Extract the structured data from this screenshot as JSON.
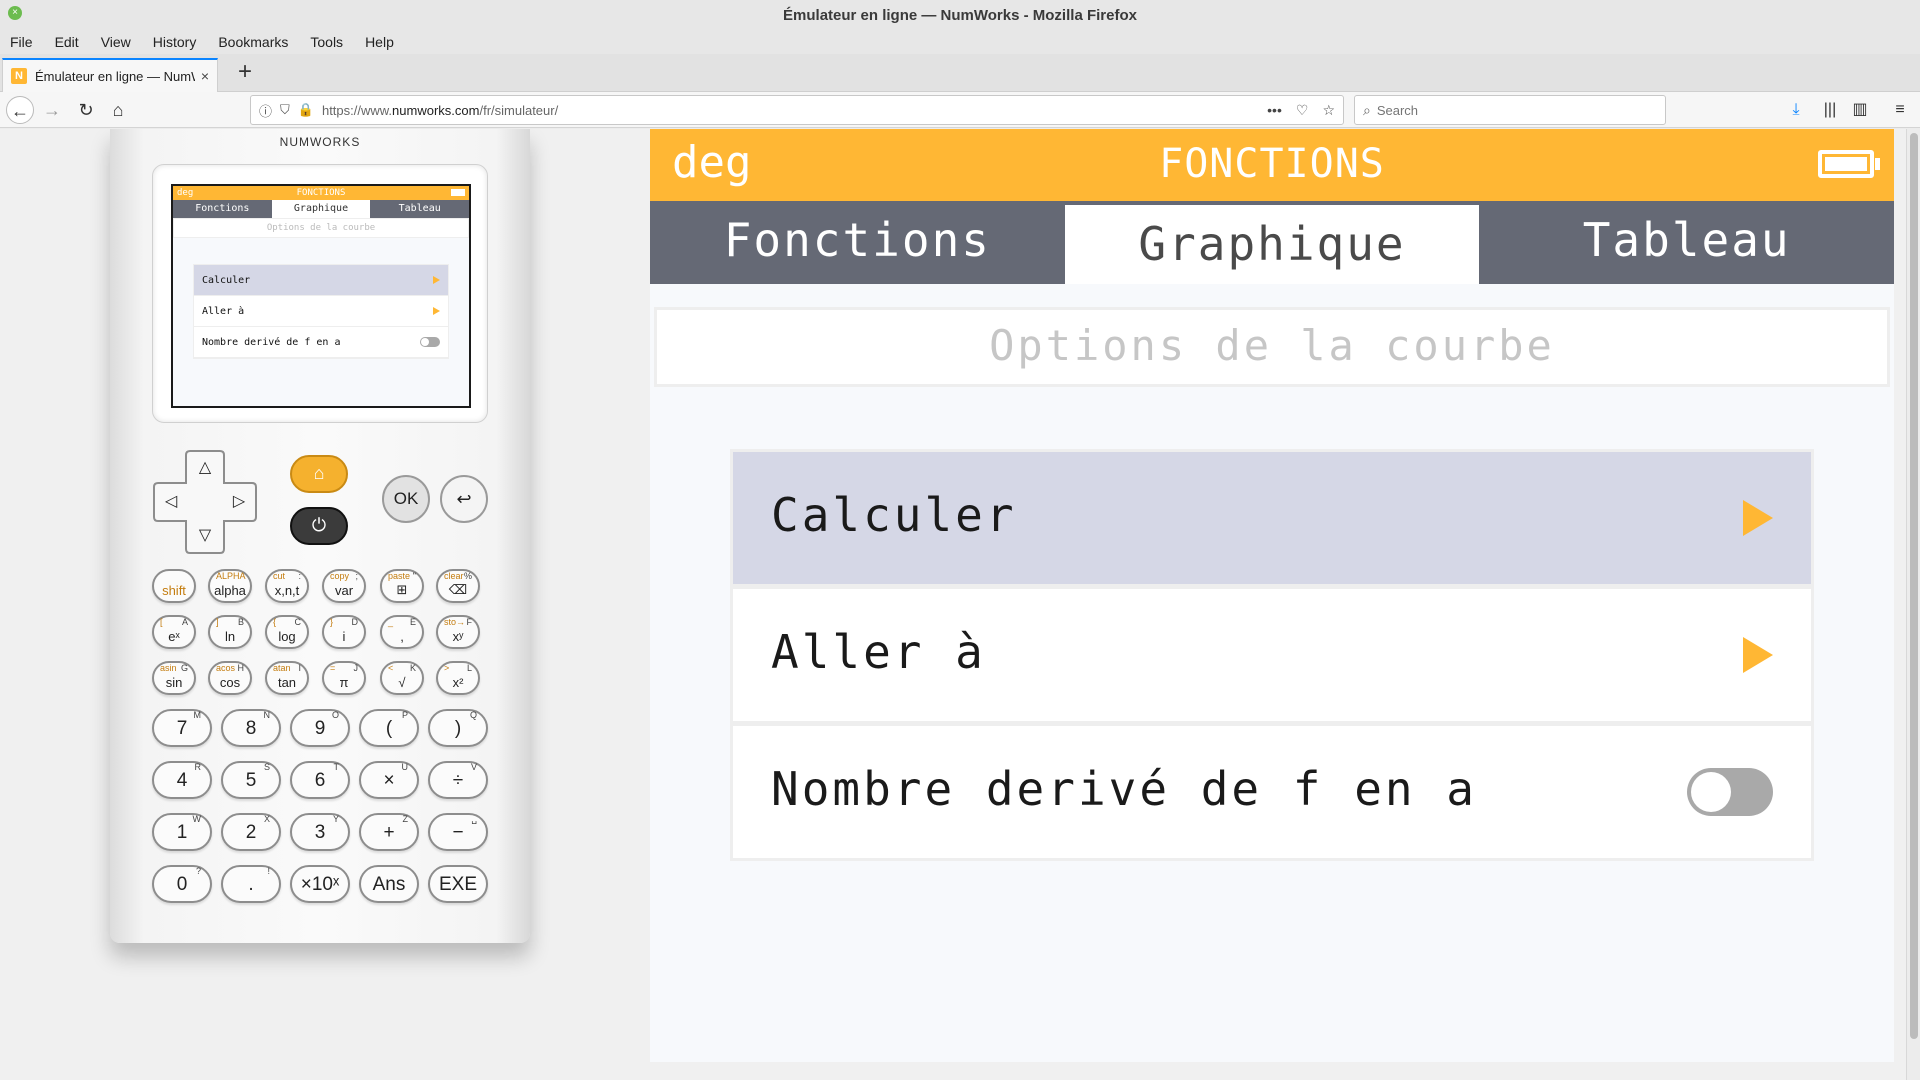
{
  "window": {
    "title": "Émulateur en ligne — NumWorks - Mozilla Firefox",
    "close_glyph": "×"
  },
  "menu": [
    "File",
    "Edit",
    "View",
    "History",
    "Bookmarks",
    "Tools",
    "Help"
  ],
  "tab": {
    "favicon": "N",
    "title": "Émulateur en ligne — NumWorks",
    "close": "×",
    "new": "+"
  },
  "nav": {
    "back": "←",
    "forward": "→",
    "reload": "↻",
    "home": "⌂",
    "url_prefix": "https://www.",
    "url_domain": "numworks.com",
    "url_path": "/fr/simulateur/",
    "page_actions": [
      "•••",
      "♡",
      "☆"
    ],
    "search_placeholder": "Search",
    "icons": {
      "download": "⤓",
      "library": "|||",
      "sidebar": "▥",
      "menu": "≡"
    }
  },
  "calculator": {
    "brand": "NUMWORKS",
    "mini_screen": {
      "left": "deg",
      "title": "FONCTIONS",
      "tabs": [
        "Fonctions",
        "Graphique",
        "Tableau"
      ],
      "subtitle": "Options de la courbe",
      "rows": [
        "Calculer",
        "Aller à",
        "Nombre derivé de f en a"
      ]
    },
    "dpad": {
      "up": "△",
      "down": "▽",
      "left": "◁",
      "right": "▷"
    },
    "home_key": "⌂",
    "power_key": "⏻",
    "ok_key": "OK",
    "back_key": "↩",
    "keys": [
      {
        "main": "shift",
        "sub": "",
        "alpha": ""
      },
      {
        "main": "alpha",
        "sub": "ALPHA",
        "alpha": ""
      },
      {
        "main": "x,n,t",
        "sub": "cut",
        "alpha": ":"
      },
      {
        "main": "var",
        "sub": "copy",
        "alpha": ";"
      },
      {
        "main": "⊞",
        "sub": "paste",
        "alpha": "\""
      },
      {
        "main": "⌫",
        "sub": "clear",
        "alpha": "%"
      },
      {
        "main": "eˣ",
        "sub": "[",
        "alpha": "A"
      },
      {
        "main": "ln",
        "sub": "]",
        "alpha": "B"
      },
      {
        "main": "log",
        "sub": "{",
        "alpha": "C"
      },
      {
        "main": "i",
        "sub": "}",
        "alpha": "D"
      },
      {
        "main": ",",
        "sub": "_",
        "alpha": "E"
      },
      {
        "main": "xʸ",
        "sub": "sto→",
        "alpha": "F"
      },
      {
        "main": "sin",
        "sub": "asin",
        "alpha": "G"
      },
      {
        "main": "cos",
        "sub": "acos",
        "alpha": "H"
      },
      {
        "main": "tan",
        "sub": "atan",
        "alpha": "I"
      },
      {
        "main": "π",
        "sub": "=",
        "alpha": "J"
      },
      {
        "main": "√",
        "sub": "<",
        "alpha": "K"
      },
      {
        "main": "x²",
        "sub": ">",
        "alpha": "L"
      }
    ],
    "num_keys": [
      {
        "main": "7",
        "alpha": "M"
      },
      {
        "main": "8",
        "alpha": "N"
      },
      {
        "main": "9",
        "alpha": "O"
      },
      {
        "main": "(",
        "alpha": "P"
      },
      {
        "main": ")",
        "alpha": "Q"
      },
      {
        "main": "4",
        "alpha": "R"
      },
      {
        "main": "5",
        "alpha": "S"
      },
      {
        "main": "6",
        "alpha": "T"
      },
      {
        "main": "×",
        "alpha": "U"
      },
      {
        "main": "÷",
        "alpha": "V"
      },
      {
        "main": "1",
        "alpha": "W"
      },
      {
        "main": "2",
        "alpha": "X"
      },
      {
        "main": "3",
        "alpha": "Y"
      },
      {
        "main": "+",
        "alpha": "Z"
      },
      {
        "main": "−",
        "alpha": "␣"
      },
      {
        "main": "0",
        "alpha": "?"
      },
      {
        "main": ".",
        "alpha": "!"
      },
      {
        "main": "×10ˣ",
        "alpha": ""
      },
      {
        "main": "Ans",
        "alpha": ""
      },
      {
        "main": "EXE",
        "alpha": ""
      }
    ]
  },
  "screen": {
    "angle_mode": "deg",
    "app_title": "FONCTIONS",
    "tabs": [
      "Fonctions",
      "Graphique",
      "Tableau"
    ],
    "active_tab": "Graphique",
    "subtitle": "Options de la courbe",
    "options": [
      {
        "label": "Calculer",
        "kind": "submenu",
        "selected": true
      },
      {
        "label": "Aller à",
        "kind": "submenu",
        "selected": false
      },
      {
        "label": "Nombre derivé de f en a",
        "kind": "toggle",
        "value": false
      }
    ],
    "colors": {
      "accent": "#ffb734",
      "tab_bar": "#656975",
      "selected_row": "#d5d7e6",
      "toggle_off": "#a9a9a9"
    }
  }
}
